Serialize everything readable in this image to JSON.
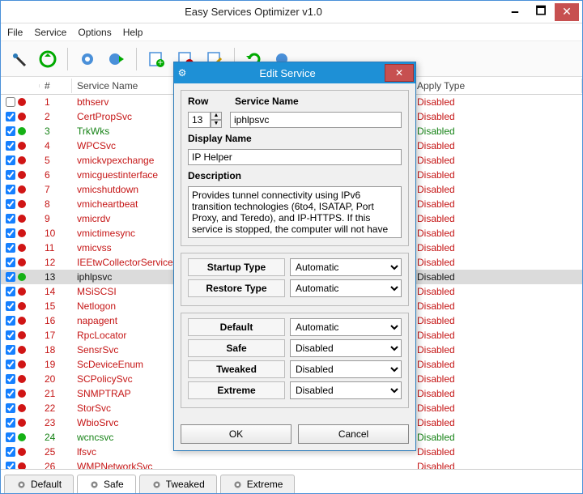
{
  "window": {
    "title": "Easy Services Optimizer v1.0",
    "min": "🗕",
    "max": "🗖",
    "close": "✕"
  },
  "menu": {
    "file": "File",
    "service": "Service",
    "options": "Options",
    "help": "Help"
  },
  "columns": {
    "row": "#",
    "name": "Service Name",
    "apply": "Apply Type"
  },
  "apply_disabled": "Disabled",
  "rows": [
    {
      "n": "1",
      "name": "bthserv",
      "dot": "red",
      "color": "red",
      "chk": false,
      "sel": false,
      "apply": "Disabled"
    },
    {
      "n": "2",
      "name": "CertPropSvc",
      "dot": "red",
      "color": "red",
      "chk": true,
      "sel": false,
      "apply": "Disabled"
    },
    {
      "n": "3",
      "name": "TrkWks",
      "dot": "green",
      "color": "green",
      "chk": true,
      "sel": false,
      "apply": "Disabled"
    },
    {
      "n": "4",
      "name": "WPCSvc",
      "dot": "red",
      "color": "red",
      "chk": true,
      "sel": false,
      "apply": "Disabled"
    },
    {
      "n": "5",
      "name": "vmickvpexchange",
      "dot": "red",
      "color": "red",
      "chk": true,
      "sel": false,
      "apply": "Disabled"
    },
    {
      "n": "6",
      "name": "vmicguestinterface",
      "dot": "red",
      "color": "red",
      "chk": true,
      "sel": false,
      "apply": "Disabled"
    },
    {
      "n": "7",
      "name": "vmicshutdown",
      "dot": "red",
      "color": "red",
      "chk": true,
      "sel": false,
      "apply": "Disabled"
    },
    {
      "n": "8",
      "name": "vmicheartbeat",
      "dot": "red",
      "color": "red",
      "chk": true,
      "sel": false,
      "apply": "Disabled"
    },
    {
      "n": "9",
      "name": "vmicrdv",
      "dot": "red",
      "color": "red",
      "chk": true,
      "sel": false,
      "apply": "Disabled"
    },
    {
      "n": "10",
      "name": "vmictimesync",
      "dot": "red",
      "color": "red",
      "chk": true,
      "sel": false,
      "apply": "Disabled"
    },
    {
      "n": "11",
      "name": "vmicvss",
      "dot": "red",
      "color": "red",
      "chk": true,
      "sel": false,
      "apply": "Disabled"
    },
    {
      "n": "12",
      "name": "IEEtwCollectorService",
      "dot": "red",
      "color": "red",
      "chk": true,
      "sel": false,
      "apply": "Disabled"
    },
    {
      "n": "13",
      "name": "iphlpsvc",
      "dot": "green",
      "color": "black",
      "chk": true,
      "sel": true,
      "apply": "Disabled"
    },
    {
      "n": "14",
      "name": "MSiSCSI",
      "dot": "red",
      "color": "red",
      "chk": true,
      "sel": false,
      "apply": "Disabled"
    },
    {
      "n": "15",
      "name": "Netlogon",
      "dot": "red",
      "color": "red",
      "chk": true,
      "sel": false,
      "apply": "Disabled"
    },
    {
      "n": "16",
      "name": "napagent",
      "dot": "red",
      "color": "red",
      "chk": true,
      "sel": false,
      "apply": "Disabled"
    },
    {
      "n": "17",
      "name": "RpcLocator",
      "dot": "red",
      "color": "red",
      "chk": true,
      "sel": false,
      "apply": "Disabled"
    },
    {
      "n": "18",
      "name": "SensrSvc",
      "dot": "red",
      "color": "red",
      "chk": true,
      "sel": false,
      "apply": "Disabled"
    },
    {
      "n": "19",
      "name": "ScDeviceEnum",
      "dot": "red",
      "color": "red",
      "chk": true,
      "sel": false,
      "apply": "Disabled"
    },
    {
      "n": "20",
      "name": "SCPolicySvc",
      "dot": "red",
      "color": "red",
      "chk": true,
      "sel": false,
      "apply": "Disabled"
    },
    {
      "n": "21",
      "name": "SNMPTRAP",
      "dot": "red",
      "color": "red",
      "chk": true,
      "sel": false,
      "apply": "Disabled"
    },
    {
      "n": "22",
      "name": "StorSvc",
      "dot": "red",
      "color": "red",
      "chk": true,
      "sel": false,
      "apply": "Disabled"
    },
    {
      "n": "23",
      "name": "WbioSrvc",
      "dot": "red",
      "color": "red",
      "chk": true,
      "sel": false,
      "apply": "Disabled"
    },
    {
      "n": "24",
      "name": "wcncsvc",
      "dot": "green",
      "color": "green",
      "chk": true,
      "sel": false,
      "apply": "Disabled"
    },
    {
      "n": "25",
      "name": "lfsvc",
      "dot": "red",
      "color": "red",
      "chk": true,
      "sel": false,
      "apply": "Disabled"
    },
    {
      "n": "26",
      "name": "WMPNetworkSvc",
      "dot": "red",
      "color": "red",
      "chk": true,
      "sel": false,
      "apply": "Disabled"
    }
  ],
  "tabs": {
    "default": "Default",
    "safe": "Safe",
    "tweaked": "Tweaked",
    "extreme": "Extreme"
  },
  "dialog": {
    "title": "Edit Service",
    "row_label": "Row",
    "svc_name_label": "Service Name",
    "row_value": "13",
    "svc_name_value": "iphlpsvc",
    "display_label": "Display Name",
    "display_value": "IP Helper",
    "desc_label": "Description",
    "desc_value": "Provides tunnel connectivity using IPv6 transition technologies (6to4, ISATAP, Port Proxy, and Teredo), and IP-HTTPS. If this service is stopped, the computer will not have",
    "startup_label": "Startup Type",
    "restore_label": "Restore Type",
    "startup_value": "Automatic",
    "restore_value": "Automatic",
    "default_label": "Default",
    "safe_label": "Safe",
    "tweaked_label": "Tweaked",
    "extreme_label": "Extreme",
    "default_value": "Automatic",
    "safe_value": "Disabled",
    "tweaked_value": "Disabled",
    "extreme_value": "Disabled",
    "ok": "OK",
    "cancel": "Cancel",
    "close": "✕"
  }
}
